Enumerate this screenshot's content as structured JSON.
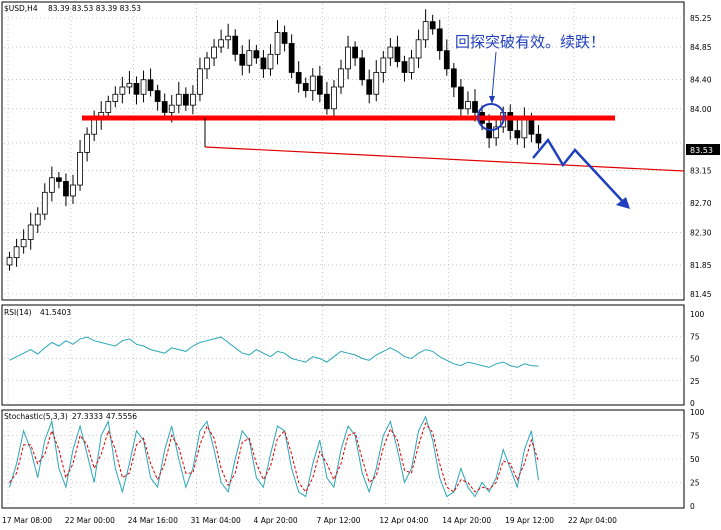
{
  "chart_header": {
    "symbol_info": "$USD,H4",
    "ohlc": "83.39 83.53 83.39 83.53"
  },
  "annotation": "回探突破有效。续跌！",
  "last_price_badge": "83.53",
  "colors": {
    "bull_candle": "#000000",
    "bear_candle": "#000000",
    "resistance_line": "#ff0000",
    "trend_line": "#e00000",
    "projection_arrow": "#1f3fbf",
    "rsi_line": "#2aa6b7",
    "stoch_main": "#2aa6b7",
    "stoch_signal": "#e00000",
    "grid": "#9aa0aa"
  },
  "chart_data": [
    {
      "type": "candlestick",
      "title": "",
      "x_ticks": [
        "17 Mar 08:00",
        "22 Mar 00:00",
        "24 Mar 16:00",
        "31 Mar 04:00",
        "4 Apr 20:00",
        "7 Apr 12:00",
        "12 Apr 04:00",
        "14 Apr 20:00",
        "19 Apr 12:00",
        "22 Apr 04:00"
      ],
      "y_ticks": [
        "85.25",
        "84.85",
        "84.40",
        "84.00",
        "83.53",
        "83.15",
        "82.70",
        "82.30",
        "81.85",
        "81.45"
      ],
      "ylim": [
        81.45,
        85.25
      ],
      "close_path": [
        81.95,
        82.1,
        82.2,
        82.4,
        82.55,
        82.85,
        83.05,
        83.0,
        82.8,
        82.95,
        83.4,
        83.65,
        83.85,
        83.95,
        84.1,
        84.2,
        84.3,
        84.35,
        84.2,
        84.4,
        84.25,
        84.1,
        83.95,
        84.05,
        84.2,
        84.05,
        84.2,
        84.55,
        84.7,
        84.85,
        84.95,
        85.0,
        84.75,
        84.6,
        84.8,
        84.7,
        84.55,
        84.75,
        85.05,
        84.9,
        84.5,
        84.35,
        84.25,
        84.45,
        84.2,
        84.0,
        84.3,
        84.55,
        84.85,
        84.7,
        84.4,
        84.2,
        84.5,
        84.7,
        84.85,
        84.65,
        84.5,
        84.7,
        84.95,
        85.2,
        85.1,
        84.8,
        84.55,
        84.3,
        84.0,
        84.1,
        83.95,
        83.8,
        83.6,
        83.75,
        83.95,
        83.7,
        83.6,
        83.85,
        83.65,
        83.53
      ],
      "levels": {
        "resistance": 84.0
      },
      "last_price": 83.53
    },
    {
      "type": "line",
      "title": "RSI(14)",
      "readout": "41.5403",
      "y_ticks": [
        "100",
        "75",
        "50",
        "25",
        "0"
      ],
      "ylim": [
        0,
        100
      ],
      "values": [
        48,
        52,
        56,
        60,
        55,
        62,
        68,
        64,
        70,
        66,
        72,
        74,
        70,
        68,
        66,
        64,
        70,
        72,
        66,
        64,
        60,
        58,
        56,
        62,
        60,
        58,
        64,
        68,
        70,
        72,
        74,
        68,
        62,
        56,
        54,
        60,
        56,
        52,
        58,
        56,
        50,
        48,
        46,
        52,
        50,
        46,
        52,
        58,
        56,
        54,
        50,
        48,
        54,
        58,
        62,
        58,
        52,
        50,
        56,
        60,
        58,
        52,
        48,
        44,
        42,
        46,
        44,
        42,
        40,
        44,
        46,
        42,
        40,
        44,
        42,
        41.5
      ]
    },
    {
      "type": "line",
      "title": "Stochastic(5,3,3)",
      "readouts": [
        "27.3333",
        "47.5556"
      ],
      "y_ticks": [
        "100",
        "75",
        "50",
        "25",
        "0"
      ],
      "ylim": [
        0,
        100
      ],
      "series": [
        {
          "values": [
            20,
            45,
            80,
            60,
            30,
            70,
            90,
            40,
            20,
            60,
            85,
            55,
            25,
            75,
            90,
            40,
            15,
            45,
            80,
            70,
            30,
            20,
            60,
            85,
            50,
            20,
            40,
            80,
            90,
            60,
            25,
            15,
            50,
            80,
            70,
            30,
            20,
            55,
            85,
            80,
            40,
            15,
            10,
            45,
            70,
            30,
            20,
            60,
            85,
            75,
            35,
            15,
            40,
            75,
            90,
            60,
            25,
            40,
            80,
            95,
            70,
            30,
            10,
            15,
            40,
            20,
            10,
            25,
            15,
            30,
            60,
            40,
            20,
            60,
            80,
            27.3
          ]
        },
        {
          "values": [
            25,
            35,
            65,
            65,
            45,
            55,
            80,
            60,
            30,
            45,
            75,
            65,
            40,
            55,
            80,
            60,
            30,
            35,
            65,
            72,
            45,
            28,
            45,
            75,
            62,
            35,
            35,
            65,
            85,
            72,
            40,
            22,
            35,
            68,
            72,
            45,
            28,
            42,
            72,
            80,
            55,
            25,
            15,
            30,
            58,
            45,
            28,
            45,
            75,
            78,
            50,
            25,
            32,
            62,
            82,
            70,
            38,
            35,
            65,
            88,
            78,
            45,
            20,
            15,
            28,
            25,
            15,
            20,
            18,
            25,
            48,
            45,
            28,
            45,
            70,
            47.6
          ]
        }
      ]
    }
  ]
}
